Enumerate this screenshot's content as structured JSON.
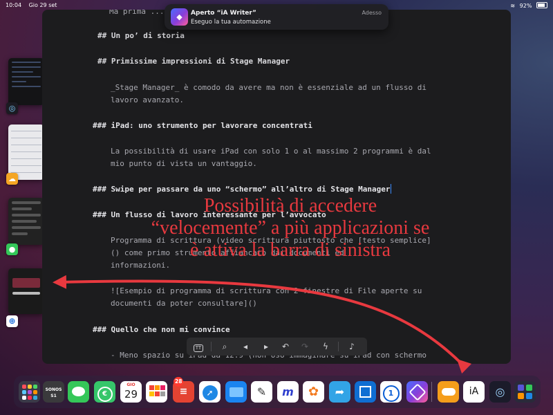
{
  "status_bar": {
    "time": "10:04",
    "date": "Gio 29 set",
    "battery": "92%"
  },
  "notification": {
    "title": "Aperto “iA Writer”",
    "body": "Eseguo la tua automazione",
    "time": "Adesso",
    "icon": "shortcuts-icon"
  },
  "editor": {
    "lines": [
      "Ma prima ...",
      "## Un po’ di storia",
      "## Primissime impressioni di Stage Manager",
      "_Stage Manager_ è comodo da avere ma non è essenziale ad un flusso di",
      "lavoro avanzato.",
      "### iPad: uno strumento per lavorare concentrati",
      "La possibilità di usare iPad con solo 1 o al massimo 2 programmi è dal",
      "mio punto di vista un vantaggio.",
      "### Swipe per passare da uno “schermo” all’altro di Stage Manager",
      "### Un flusso di lavoro interessante per l’avvocato",
      "Programma di scrittura (video scrittura piuttosto che [testo semplice]",
      "() come primo strumento affiancato dai documenti ed",
      "informazioni.",
      "![Esempio di programma di scrittura con 2 finestre di File aperte su",
      "documenti da poter consultare]()",
      "### Quello che non mi convince",
      "- Meno spazio su iPad da 12.9 (non oso immaginare su iPad con schermo"
    ],
    "toolbar": [
      "text-format-icon",
      "search-icon",
      "arrow-left-icon",
      "arrow-right-icon",
      "undo-icon",
      "redo-icon",
      "flash-icon",
      "microphone-icon"
    ]
  },
  "annotation": {
    "lines": [
      "Possibilità di accedere",
      "“velocemente” a più applicazioni se",
      "è attiva la barra di sinistra"
    ],
    "color": "#e8393f"
  },
  "stage_manager": [
    "code-editor-window",
    "spreadsheet-window",
    "messages-window",
    "safari-window"
  ],
  "dock": {
    "apps": [
      {
        "name": "App Library",
        "icon": "app-library-icon"
      },
      {
        "name": "Sonos",
        "label": "SONOS S1",
        "icon": "sonos-icon"
      },
      {
        "name": "Messaggi",
        "icon": "messages-icon"
      },
      {
        "name": "Money",
        "glyph": "€",
        "icon": "money-icon"
      },
      {
        "name": "Calendario",
        "day": "GIO",
        "date": "29",
        "icon": "calendar-icon"
      },
      {
        "name": "Fantastical",
        "icon": "fantastical-icon"
      },
      {
        "name": "Todoist",
        "badge": "28",
        "icon": "todoist-icon"
      },
      {
        "name": "Safari",
        "icon": "safari-icon"
      },
      {
        "name": "File",
        "icon": "files-icon"
      },
      {
        "name": "Notes",
        "icon": "notes-icon"
      },
      {
        "name": "Mail",
        "icon": "m-icon"
      },
      {
        "name": "Affinity",
        "icon": "flower-icon"
      },
      {
        "name": "Share",
        "icon": "share-icon"
      },
      {
        "name": "Square",
        "icon": "square-icon"
      },
      {
        "name": "1Password",
        "glyph": "1",
        "icon": "1password-icon"
      },
      {
        "name": "Comandi Rapidi",
        "icon": "shortcuts-icon"
      },
      {
        "name": "iCloud",
        "icon": "cloud-icon"
      },
      {
        "name": "iA Writer",
        "glyph": "iA",
        "icon": "ia-writer-icon"
      },
      {
        "name": "Touch ID",
        "icon": "fingerprint-icon"
      },
      {
        "name": "Recenti",
        "icon": "recent-apps-icon"
      }
    ]
  }
}
